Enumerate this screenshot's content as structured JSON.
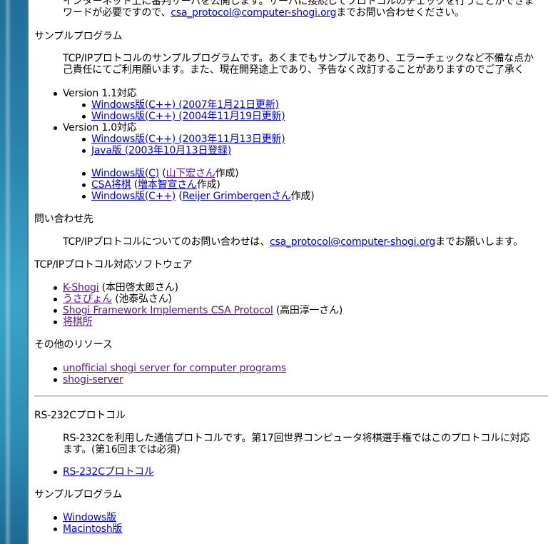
{
  "top": {
    "line1": "インターネット上に審判サーバを公開します。サーバに接続してプロトコルのチェックを行うことができま",
    "line2_pre": "ワードが必要ですので、",
    "email": "csa_protocol@computer-shogi.org",
    "line2_post": "までお問い合わせください。"
  },
  "sample": {
    "heading": "サンプルプログラム",
    "desc_line1": "TCP/IPプロトコルのサンプルプログラムです。あくまでもサンプルであり、エラーチェックなど不備な点か",
    "desc_line2": "己責任にてご利用願います。また、現在開発途上であり、予告なく改訂することがありますのでご了承く",
    "v11": "Version 1.1対応",
    "v11_items": [
      "Windows版(C++) (2007年1月21日更新)",
      "Windows版(C++) (2004年11月19日更新)"
    ],
    "v10": "Version 1.0対応",
    "v10_items": [
      "Windows版(C++) (2003年11月13日更新)",
      "Java版 (2003年10月13日登録)"
    ],
    "others": [
      {
        "link": "Windows版(C)",
        "mid": " (",
        "person": "山下宏さん",
        "post": "作成)"
      },
      {
        "link": "CSA将棋",
        "mid": " (",
        "person": "増本智宣さん",
        "post": "作成)"
      },
      {
        "link": "Windows版(C++)",
        "mid": " (",
        "person": "Reijer Grimbergenさん",
        "post": "作成)"
      }
    ]
  },
  "contact": {
    "heading": "問い合わせ先",
    "pre": "TCP/IPプロトコルについてのお問い合わせは、",
    "email": "csa_protocol@computer-shogi.org",
    "post": "までお願いします。"
  },
  "software": {
    "heading": "TCP/IPプロトコル対応ソフトウェア",
    "items": [
      {
        "link": "K-Shogi",
        "post": " (本田啓太郎さん)"
      },
      {
        "link": "うさぴょん",
        "post": " (池泰弘さん)"
      },
      {
        "link": "Shogi Framework Implements CSA Protocol",
        "post": " (高田淳一さん)"
      },
      {
        "link": "将棋所",
        "post": ""
      }
    ]
  },
  "resources": {
    "heading": "その他のリソース",
    "items": [
      "unofficial shogi server for computer programs",
      "shogi-server"
    ]
  },
  "rs232c": {
    "heading": "RS-232Cプロトコル",
    "desc_line1": "RS-232Cを利用した通信プロトコルです。第17回世界コンピュータ将棋選手権ではこのプロトコルに対応",
    "desc_line2": "ます。(第16回までは必須)",
    "link": "RS-232Cプロトコル"
  },
  "rs_sample": {
    "heading": "サンプルプログラム",
    "items": [
      "Windows版",
      "Macintosh版"
    ]
  },
  "colors": {
    "link": "#0000ee",
    "visited": "#551a8b",
    "frame": "#2a86b0"
  }
}
